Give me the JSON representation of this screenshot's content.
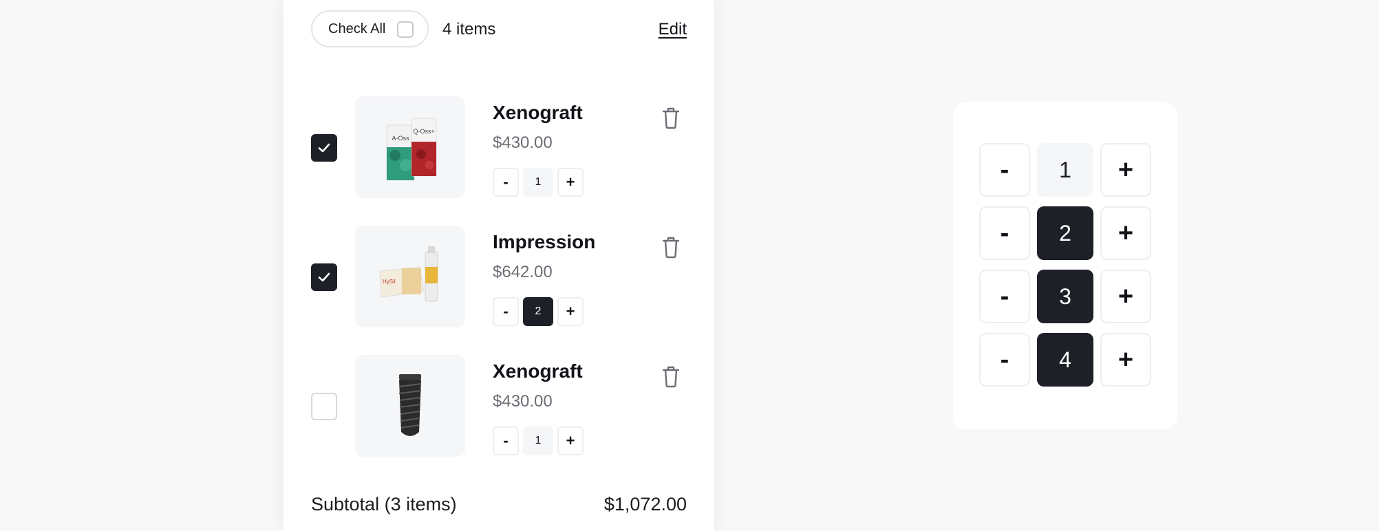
{
  "header": {
    "check_all_label": "Check All",
    "item_count": "4 items",
    "edit_label": "Edit"
  },
  "items": [
    {
      "name": "Xenograft",
      "price": "$430.00",
      "quantity": "1",
      "checked": true,
      "image": "bone-graft-boxes",
      "packs": [
        "A-Oss",
        "Q-Oss+"
      ]
    },
    {
      "name": "Impression",
      "price": "$642.00",
      "quantity": "2",
      "checked": true,
      "image": "impression-material-box",
      "box_text": "HySil"
    },
    {
      "name": "Xenograft",
      "price": "$430.00",
      "quantity": "1",
      "checked": false,
      "image": "dental-implant-screw"
    }
  ],
  "stepper_symbols": {
    "minus": "-",
    "plus": "+"
  },
  "subtotal": {
    "label": "Subtotal (3 items)",
    "value": "$1,072.00"
  },
  "quantity_demo": [
    {
      "value": "1",
      "active": false
    },
    {
      "value": "2",
      "active": true
    },
    {
      "value": "3",
      "active": true
    },
    {
      "value": "4",
      "active": true
    }
  ],
  "colors": {
    "dark": "#1d2127",
    "muted_text": "#6b6e74",
    "border": "#eceef0",
    "tile": "#f5f6f8"
  }
}
